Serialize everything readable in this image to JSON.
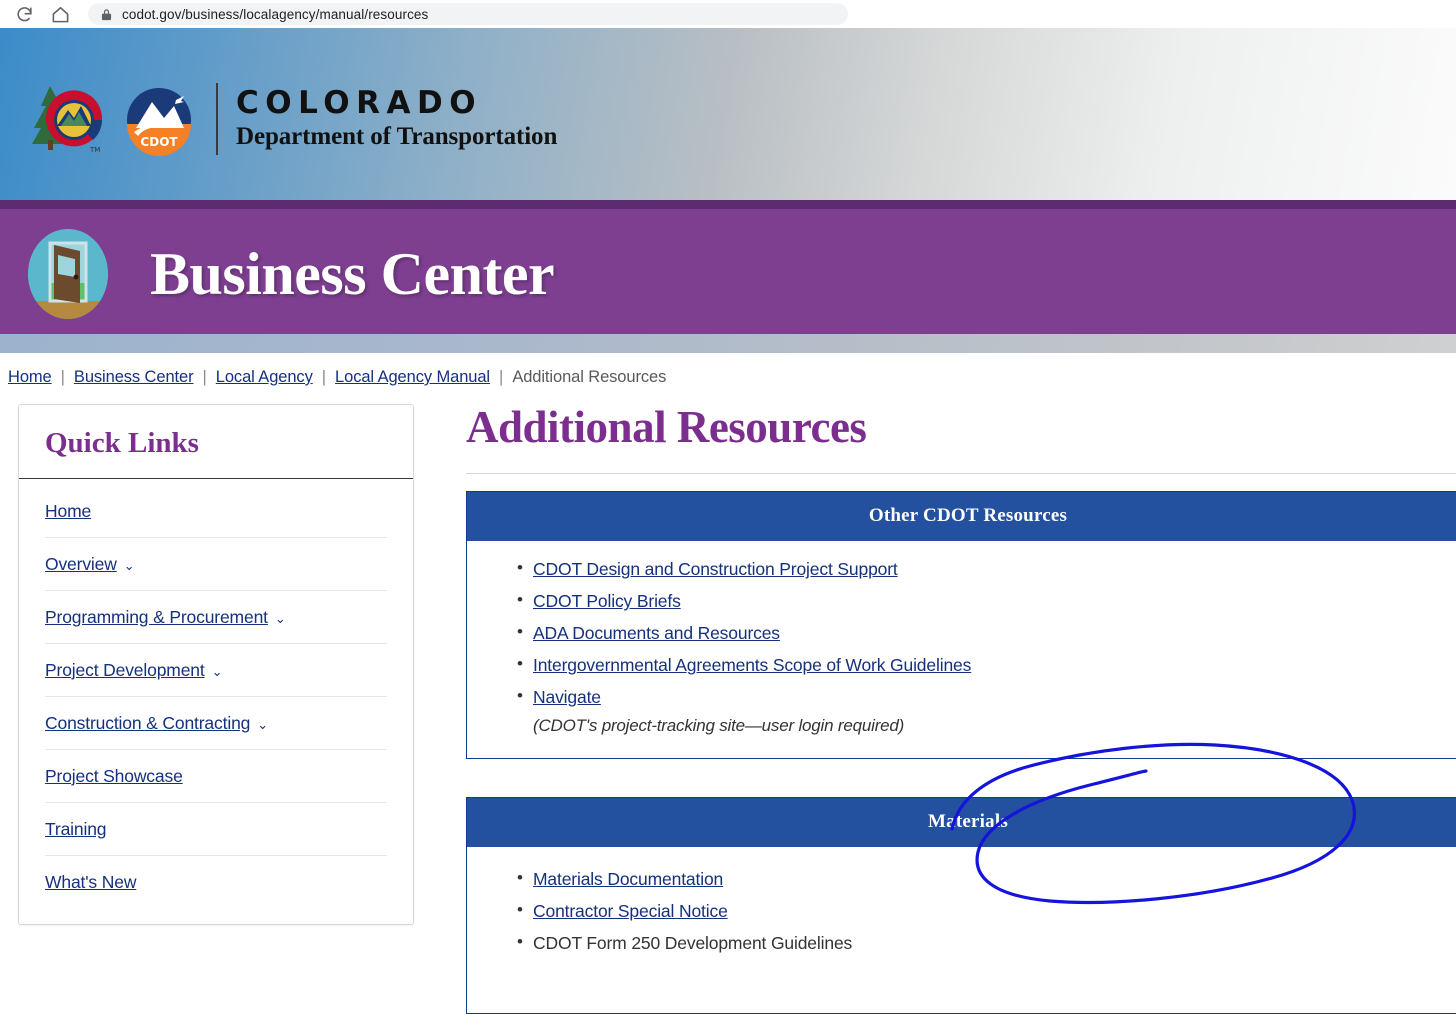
{
  "browser": {
    "reload_icon": "reload-icon",
    "home_icon": "home-icon",
    "lock_icon": "lock-icon",
    "url": "codot.gov/business/localagency/manual/resources"
  },
  "site_header": {
    "logo_icon": "colorado-cdot-logo",
    "cdot_badge_label": "CDOT",
    "agency_name": "COLORADO",
    "agency_dept": "Department of Transportation"
  },
  "section_banner": {
    "icon": "open-door-icon",
    "title": "Business Center"
  },
  "breadcrumb": {
    "separator": "|",
    "items": [
      {
        "label": "Home",
        "current": false
      },
      {
        "label": "Business Center",
        "current": false
      },
      {
        "label": "Local Agency",
        "current": false
      },
      {
        "label": "Local Agency Manual",
        "current": false
      },
      {
        "label": "Additional Resources",
        "current": true
      }
    ]
  },
  "sidebar": {
    "title": "Quick Links",
    "items": [
      {
        "label": "Home",
        "caret": ""
      },
      {
        "label": "Overview",
        "caret": "⌄"
      },
      {
        "label": "Programming & Procurement",
        "caret": "⌄"
      },
      {
        "label": "Project Development",
        "caret": "⌄"
      },
      {
        "label": "Construction & Contracting",
        "caret": "⌄"
      },
      {
        "label": "Project Showcase",
        "caret": ""
      },
      {
        "label": "Training",
        "caret": ""
      },
      {
        "label": "What's New",
        "caret": ""
      }
    ]
  },
  "main": {
    "title": "Additional Resources",
    "cards": [
      {
        "heading": "Other CDOT Resources",
        "links": [
          {
            "label": "CDOT Design and Construction Project Support",
            "is_link": true
          },
          {
            "label": "CDOT Policy Briefs",
            "is_link": true
          },
          {
            "label": "ADA Documents and Resources",
            "is_link": true
          },
          {
            "label": "Intergovernmental Agreements Scope of Work Guidelines",
            "is_link": true
          },
          {
            "label": "Navigate",
            "is_link": true
          }
        ],
        "note": "(CDOT's project-tracking site—user login required)"
      },
      {
        "heading": "Materials",
        "links": [
          {
            "label": "Materials Documentation",
            "is_link": true
          },
          {
            "label": "Contractor Special Notice",
            "is_link": true
          },
          {
            "label": "CDOT Form 250 Development Guidelines",
            "is_link": false
          }
        ],
        "note": ""
      }
    ]
  },
  "annotation": {
    "name": "hand-drawn-circle-around-materials",
    "color": "#1414dc",
    "stroke_width": 3
  },
  "colors": {
    "purple_band": "#7e3f91",
    "purple_band_top": "#5d2b6f",
    "heading_purple": "#7b2e8e",
    "card_blue": "#2450a0",
    "card_border": "#123a8a",
    "link_blue": "#15317e",
    "banner_blue": "#3c8cc9"
  }
}
